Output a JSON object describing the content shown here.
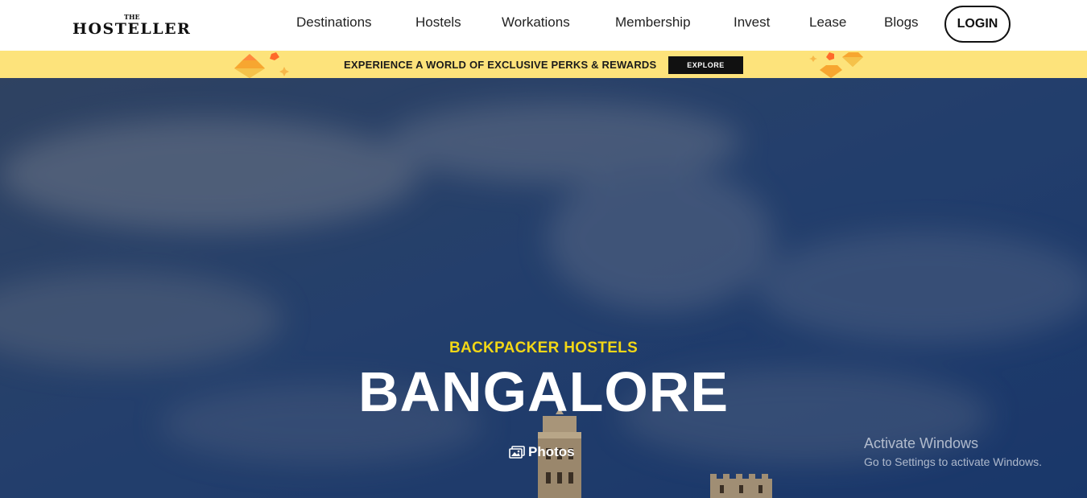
{
  "header": {
    "logo": {
      "small": "THE",
      "word": "HOSTELLER"
    },
    "nav": [
      {
        "label": "Destinations"
      },
      {
        "label": "Hostels"
      },
      {
        "label": "Workations"
      },
      {
        "label": "Membership"
      },
      {
        "label": "Invest"
      },
      {
        "label": "Lease"
      },
      {
        "label": "Blogs"
      }
    ],
    "login_label": "LOGIN"
  },
  "promo": {
    "text": "EXPERIENCE A WORLD OF EXCLUSIVE PERKS & REWARDS",
    "button_label": "EXPLORE",
    "bg_color": "#fde37b"
  },
  "hero": {
    "subtitle": "BACKPACKER HOSTELS",
    "title": "BANGALORE",
    "photos_label": "Photos",
    "subtitle_color": "#f2d716"
  },
  "watermark": {
    "title": "Activate Windows",
    "subtitle": "Go to Settings to activate Windows."
  }
}
